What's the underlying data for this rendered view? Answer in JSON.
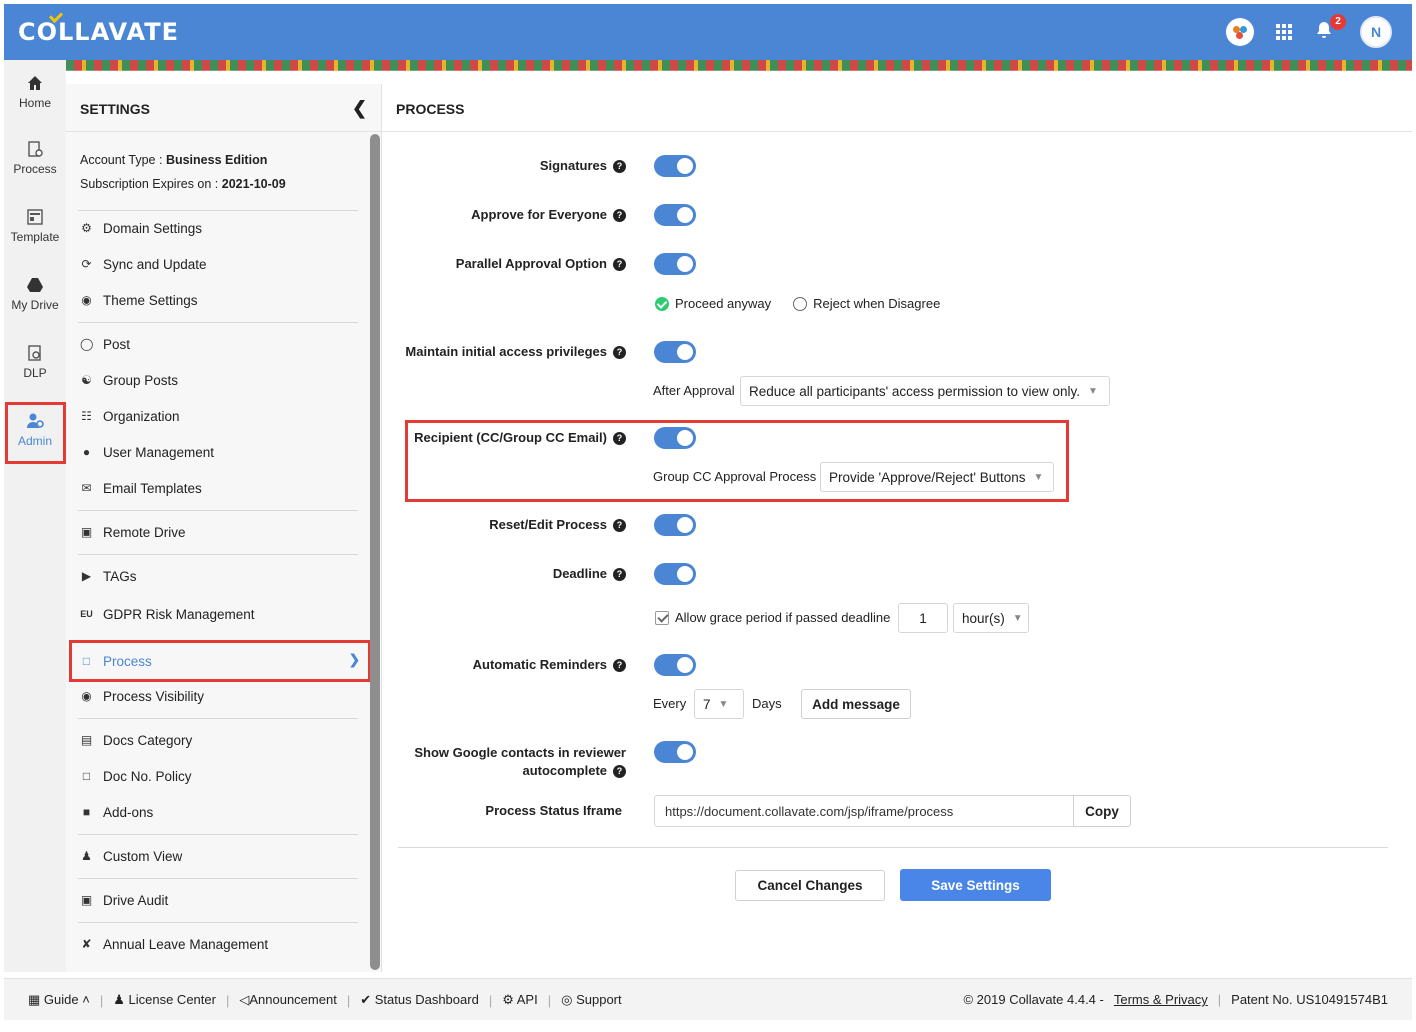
{
  "header": {
    "logo": "COLLAVATE",
    "notification_count": "2",
    "avatar_text": "N"
  },
  "nav": [
    {
      "label": "Home",
      "icon": "home-icon"
    },
    {
      "label": "Process",
      "icon": "process-icon"
    },
    {
      "label": "Template",
      "icon": "template-icon"
    },
    {
      "label": "My Drive",
      "icon": "drive-icon"
    },
    {
      "label": "DLP",
      "icon": "dlp-icon"
    },
    {
      "label": "Admin",
      "icon": "admin-icon"
    }
  ],
  "settings": {
    "title": "SETTINGS",
    "account_type_label": "Account Type : ",
    "account_type": "Business Edition",
    "subscription_label": "Subscription Expires on : ",
    "subscription_date": "2021-10-09",
    "menu": [
      {
        "label": "Domain Settings",
        "icon": "gear-icon"
      },
      {
        "label": "Sync and Update",
        "icon": "sync-icon"
      },
      {
        "label": "Theme Settings",
        "icon": "palette-icon"
      },
      {
        "label": "Post",
        "icon": "chat-icon"
      },
      {
        "label": "Group Posts",
        "icon": "group-icon"
      },
      {
        "label": "Organization",
        "icon": "org-icon"
      },
      {
        "label": "User Management",
        "icon": "user-icon"
      },
      {
        "label": "Email Templates",
        "icon": "mail-icon"
      },
      {
        "label": "Remote Drive",
        "icon": "drive-icon"
      },
      {
        "label": "TAGs",
        "icon": "tag-icon"
      },
      {
        "label": "GDPR Risk Management",
        "icon": "eu-icon"
      },
      {
        "label": "Process",
        "icon": "process-icon"
      },
      {
        "label": "Process Visibility",
        "icon": "eye-icon"
      },
      {
        "label": "Docs Category",
        "icon": "doc-icon"
      },
      {
        "label": "Doc No. Policy",
        "icon": "file-icon"
      },
      {
        "label": "Add-ons",
        "icon": "lock-icon"
      },
      {
        "label": "Custom View",
        "icon": "person-icon"
      },
      {
        "label": "Drive Audit",
        "icon": "drive-icon"
      },
      {
        "label": "Annual Leave Management",
        "icon": "plane-icon"
      }
    ]
  },
  "main": {
    "title": "PROCESS",
    "signatures": "Signatures",
    "approve_everyone": "Approve for Everyone",
    "parallel_approval": "Parallel Approval Option",
    "proceed_anyway": "Proceed anyway",
    "reject_disagree": "Reject when Disagree",
    "maintain_access": "Maintain initial access privileges",
    "after_approval": "After Approval",
    "after_approval_value": "Reduce all participants' access permission to view only.",
    "recipient": "Recipient (CC/Group CC Email)",
    "group_cc_label": "Group CC Approval Process",
    "group_cc_value": "Provide 'Approve/Reject' Buttons",
    "reset_edit": "Reset/Edit Process",
    "deadline": "Deadline",
    "grace_period": "Allow grace period if passed deadline",
    "grace_value": "1",
    "grace_unit": "hour(s)",
    "auto_reminders": "Automatic Reminders",
    "every": "Every",
    "every_value": "7",
    "days": "Days",
    "add_message": "Add message",
    "google_contacts_1": "Show Google contacts in reviewer",
    "google_contacts_2": "autocomplete",
    "iframe_label": "Process Status Iframe",
    "iframe_url": "https://document.collavate.com/jsp/iframe/process",
    "copy": "Copy",
    "cancel": "Cancel Changes",
    "save": "Save Settings"
  },
  "footer": {
    "guide": "Guide",
    "license": "License Center",
    "announcement": "Announcement",
    "status": "Status Dashboard",
    "api": "API",
    "support": "Support",
    "copyright": "© 2019 Collavate 4.4.4 -",
    "terms": "Terms & Privacy",
    "patent": "Patent No. US10491574B1"
  }
}
